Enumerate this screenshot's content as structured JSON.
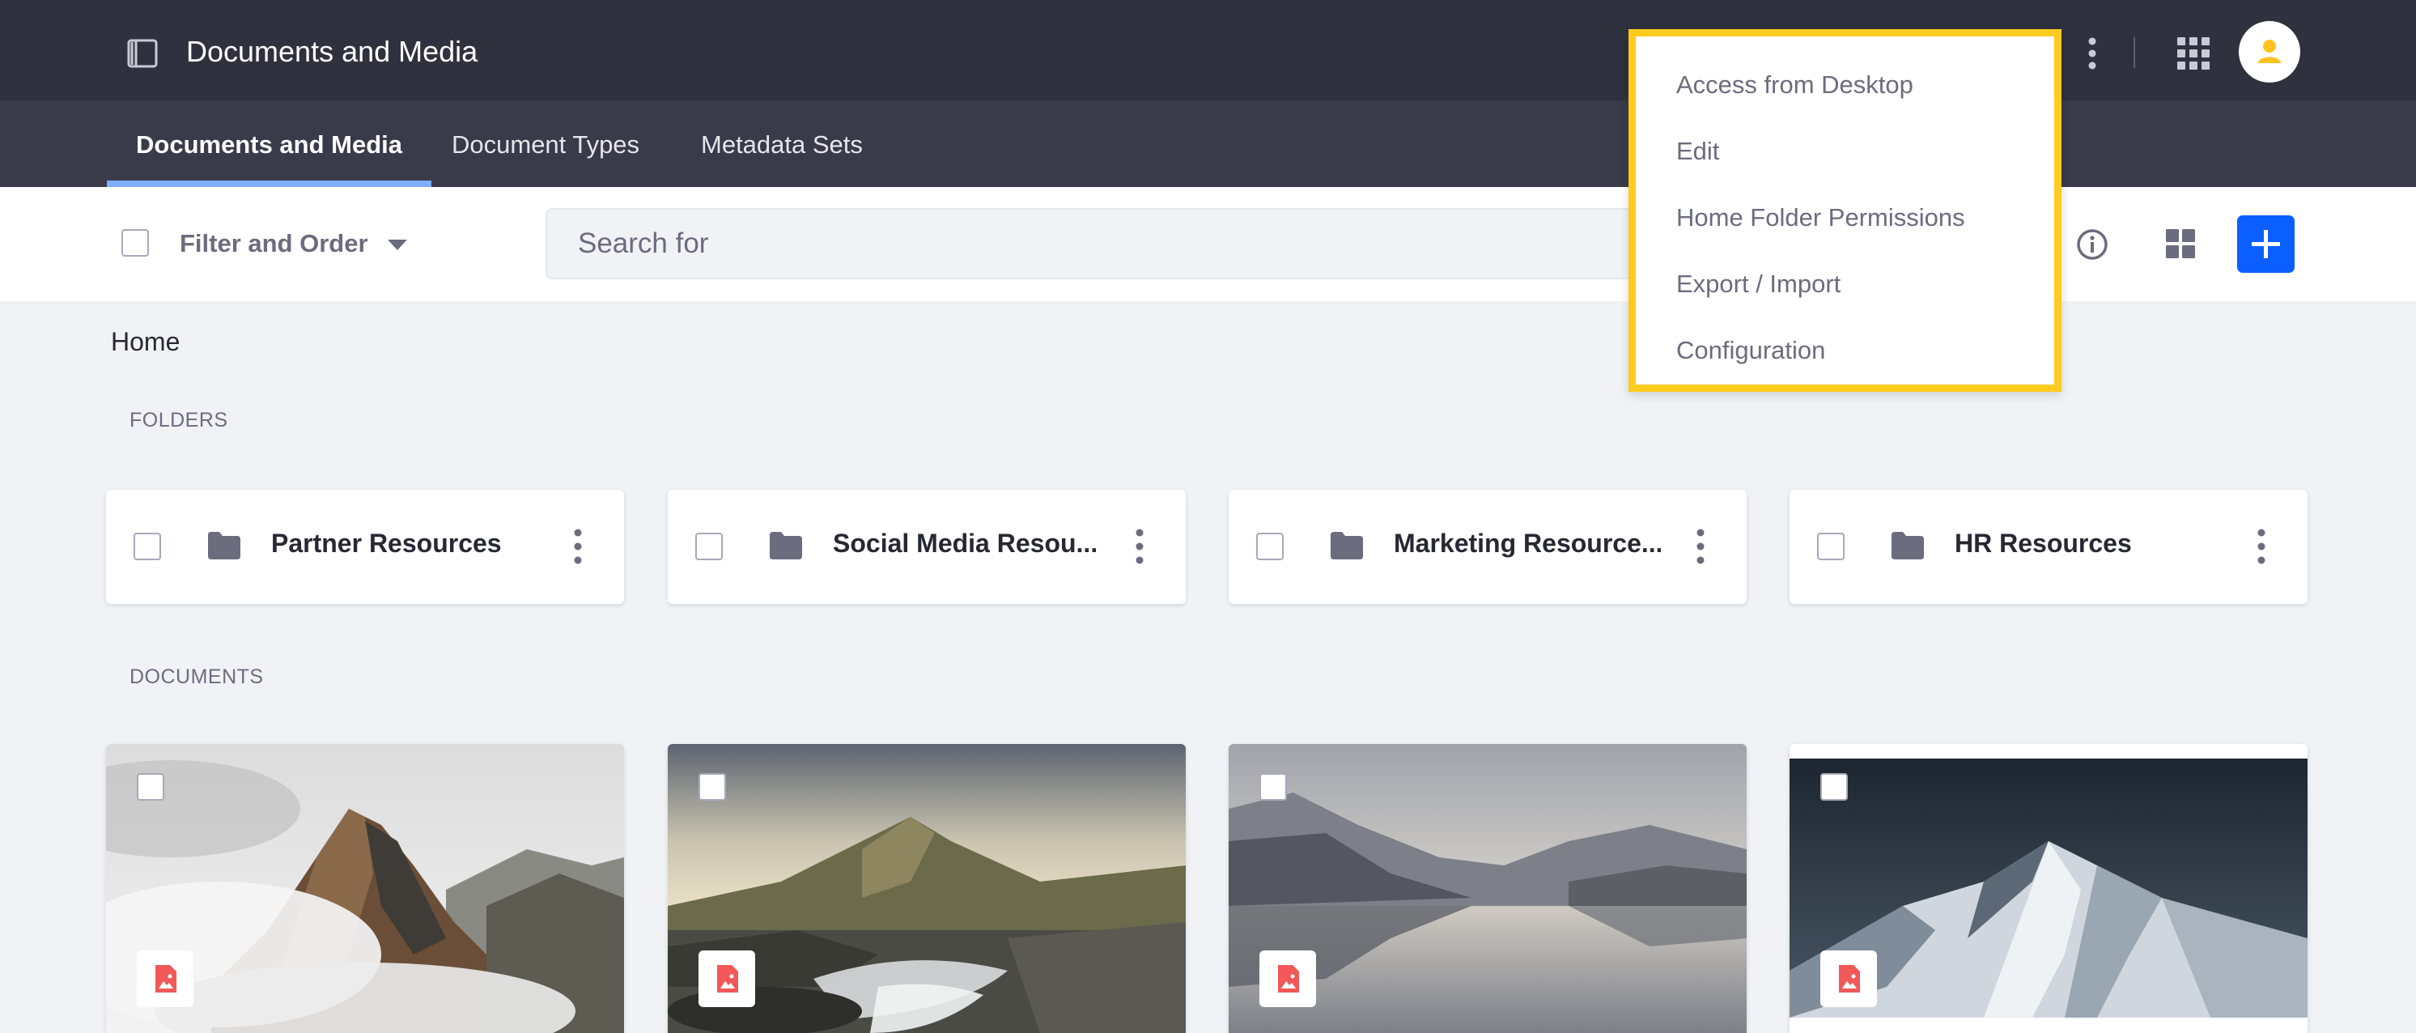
{
  "header": {
    "title": "Documents and Media",
    "icons": [
      "product-menu-icon",
      "kebab-icon",
      "apps-grid-icon",
      "user-avatar-icon"
    ]
  },
  "tabs": [
    {
      "label": "Documents and Media",
      "active": true
    },
    {
      "label": "Document Types",
      "active": false
    },
    {
      "label": "Metadata Sets",
      "active": false
    }
  ],
  "toolbar": {
    "filter_label": "Filter and Order",
    "search_placeholder": "Search for",
    "icons": [
      "info-icon",
      "cards-view-icon",
      "plus-icon"
    ]
  },
  "breadcrumb": "Home",
  "folders_label": "FOLDERS",
  "folders": [
    {
      "name": "Partner Resources"
    },
    {
      "name": "Social Media Resou..."
    },
    {
      "name": "Marketing Resource..."
    },
    {
      "name": "HR Resources"
    }
  ],
  "documents_label": "DOCUMENTS",
  "documents": [
    {
      "image": "rocky-mountain-in-clouds"
    },
    {
      "image": "mountain-stream"
    },
    {
      "image": "lake-reflection"
    },
    {
      "image": "snowy-peak"
    }
  ],
  "menu": {
    "items": [
      "Access from Desktop",
      "Edit",
      "Home Folder Permissions",
      "Export / Import",
      "Configuration"
    ],
    "highlight_color": "#ffcb1f"
  },
  "colors": {
    "topbar": "#30313f",
    "navbar": "#393a4a",
    "accent": "#0b5fff",
    "active_tab_indicator": "#80acff",
    "file_icon": "#f25858"
  }
}
